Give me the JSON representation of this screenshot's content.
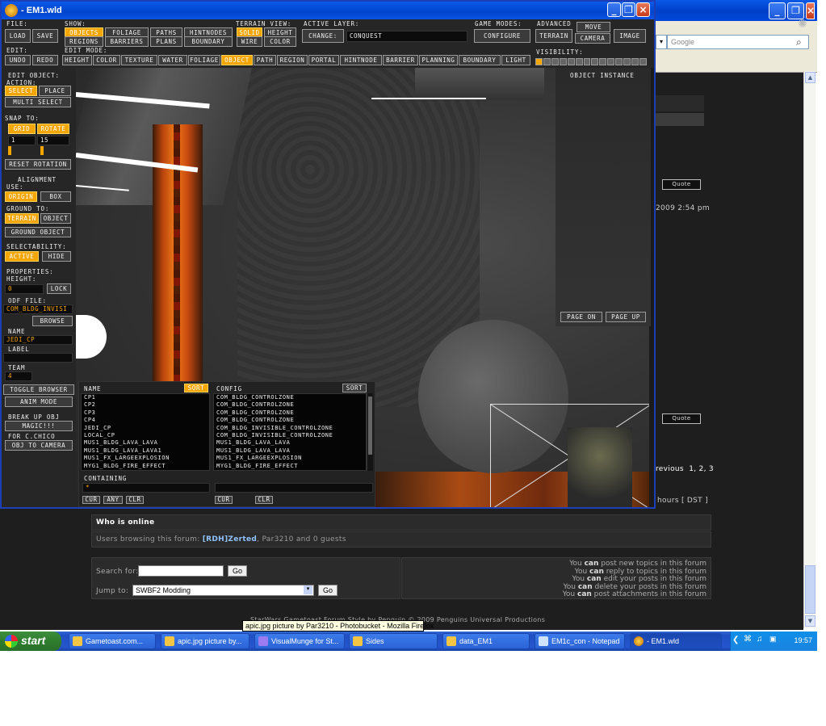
{
  "editor": {
    "title": "EM1.wld",
    "top": {
      "file_label": "File:",
      "load": "Load",
      "save": "Save",
      "show_label": "Show:",
      "show_buttons": [
        "Objects",
        "Foliage",
        "Paths",
        "HintNodes",
        "Regions",
        "Barriers",
        "Plans",
        "Boundary"
      ],
      "terrain_view_label": "Terrain View:",
      "terrain_buttons": [
        "Solid",
        "Height",
        "Wire",
        "Color"
      ],
      "active_layer_label": "Active Layer:",
      "change": "Change:",
      "layer_value": "conquest",
      "game_modes_label": "Game Modes:",
      "configure": "Configure",
      "advanced_label": "Advanced",
      "advanced_buttons": [
        "Move",
        "Terrain",
        "Camera",
        "Image"
      ],
      "edit_label": "Edit:",
      "undo": "Undo",
      "redo": "Redo",
      "edit_mode_label": "Edit Mode:",
      "modes": [
        "Height",
        "Color",
        "Texture",
        "Water",
        "Foliage",
        "Object",
        "Path",
        "Region",
        "Portal",
        "HintNode",
        "Barrier",
        "Planning",
        "Boundary",
        "Light"
      ],
      "visibility_label": "Visibility:"
    },
    "left": {
      "edit_object": "Edit Object:",
      "action": "Action:",
      "select": "Select",
      "place": "Place",
      "multi_select": "Multi Select",
      "snap_to": "Snap To:",
      "grid": "Grid",
      "rotate": "Rotate",
      "grid_value": "1",
      "rotate_value": "15",
      "reset_rotation": "Reset Rotation",
      "alignment": "Alignment",
      "use": "Use:",
      "origin": "Origin",
      "box": "Box",
      "ground_to": "Ground To:",
      "terrain": "Terrain",
      "object": "Object",
      "ground_object": "Ground Object",
      "selectability": "Selectability:",
      "active": "Active",
      "hide": "Hide",
      "properties": "Properties:",
      "height": "Height:",
      "height_value": "0",
      "lock": "Lock",
      "odf_file": "Odf File:",
      "odf_value": "com_bldg_invisi",
      "browse": "Browse",
      "name": "Name",
      "name_value": "jedi_cp",
      "label": "Label",
      "team": "Team",
      "team_value": "4",
      "toggle_browser": "Toggle Browser",
      "anim_mode": "Anim Mode",
      "break_up_obj": "Break Up Obj",
      "magic": "Magic!!!",
      "for_chico": "For C.Chico",
      "obj_to_camera": "Obj To Camera"
    },
    "object_instance": "Object Instance",
    "page_on": "Page On",
    "page_up": "Page Up",
    "browser": {
      "name_header": "Name",
      "config_header": "Config",
      "sort": "Sort",
      "names": [
        "CP1",
        "CP2",
        "CP3",
        "CP4",
        "JEDI_CP",
        "LOCAL_CP",
        "MUS1_BLDG_LAVA_LAVA",
        "MUS1_BLDG_LAVA_LAVA1",
        "MUS1_FX_LARGEEXPLOSION",
        "MYG1_BLDG_FIRE_EFFECT"
      ],
      "configs": [
        "COM_BLDG_CONTROLZONE",
        "COM_BLDG_CONTROLZONE",
        "COM_BLDG_CONTROLZONE",
        "COM_BLDG_CONTROLZONE",
        "COM_BLDG_INVISIBLE_CONTROLZONE",
        "COM_BLDG_INVISIBLE_CONTROLZONE",
        "MUS1_BLDG_LAVA_LAVA",
        "MUS1_BLDG_LAVA_LAVA",
        "MUS1_FX_LARGEEXPLOSION",
        "MYG1_BLDG_FIRE_EFFECT"
      ],
      "containing": "Containing",
      "containing_value": "*",
      "cur": "Cur",
      "any": "Any",
      "clr": "Clr"
    }
  },
  "forum": {
    "search_placeholder": "Google",
    "quote": "Quote",
    "post_time": "2009 2:54 pm",
    "pagination_prefix": "revious",
    "pages": "1, 2, 3",
    "tz": "hours [ DST ]",
    "who_is_online": "Who is online",
    "users_browsing_prefix": "Users browsing this forum:",
    "user1": "[RDH]Zerted",
    "users_browsing_suffix": ", Par3210 and 0 guests",
    "search_for": "Search for:",
    "go": "Go",
    "jump_to": "Jump to:",
    "jump_value": "SWBF2 Modding",
    "permissions": [
      [
        "You ",
        "can",
        " post new topics in this forum"
      ],
      [
        "You ",
        "can",
        " reply to topics in this forum"
      ],
      [
        "You ",
        "can",
        " edit your posts in this forum"
      ],
      [
        "You ",
        "can",
        " delete your posts in this forum"
      ],
      [
        "You ",
        "can",
        " post attachments in this forum"
      ]
    ],
    "footer": "StarWars Gametoast Forum Style by Penguin © 2009 Penguins Universal Productions"
  },
  "tooltip": "apic.jpg picture by Par3210 - Photobucket - Mozilla Firefox",
  "taskbar": {
    "start": "start",
    "tasks": [
      "Gametoast.com...",
      "apic.jpg picture by...",
      "VisualMunge for St...",
      "Sides",
      "data_EM1",
      "EM1c_con - Notepad",
      "- EM1.wld"
    ],
    "clock": "19:57"
  }
}
